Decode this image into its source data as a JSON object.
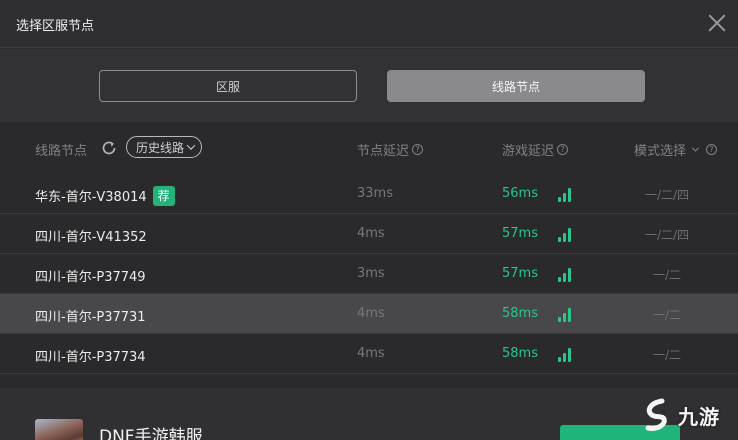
{
  "dialog": {
    "title": "选择区服节点"
  },
  "tabs": [
    {
      "label": "区服",
      "active": false
    },
    {
      "label": "线路节点",
      "active": true
    }
  ],
  "header": {
    "node_label": "线路节点",
    "history_label": "历史线路",
    "node_delay_label": "节点延迟",
    "game_delay_label": "游戏延迟",
    "mode_label": "模式选择"
  },
  "rows": [
    {
      "name": "华东-首尔-V38014",
      "badge": "荐",
      "node_delay": "33ms",
      "game_delay": "56ms",
      "mode": "一/二/四",
      "selected": false
    },
    {
      "name": "四川-首尔-V41352",
      "node_delay": "4ms",
      "game_delay": "57ms",
      "mode": "一/二/四",
      "selected": false
    },
    {
      "name": "四川-首尔-P37749",
      "node_delay": "3ms",
      "game_delay": "57ms",
      "mode": "一/二",
      "selected": false
    },
    {
      "name": "四川-首尔-P37731",
      "node_delay": "4ms",
      "game_delay": "58ms",
      "mode": "一/二",
      "selected": true
    },
    {
      "name": "四川-首尔-P37734",
      "node_delay": "4ms",
      "game_delay": "58ms",
      "mode": "一/二",
      "selected": false
    }
  ],
  "footer": {
    "game_title": "DNF手游韩服"
  },
  "watermark": {
    "text": "九游"
  },
  "colors": {
    "accent": "#2bc489",
    "badge": "#22b37a",
    "selected_row": "#48484c",
    "active_tab": "#8a8a8e"
  }
}
